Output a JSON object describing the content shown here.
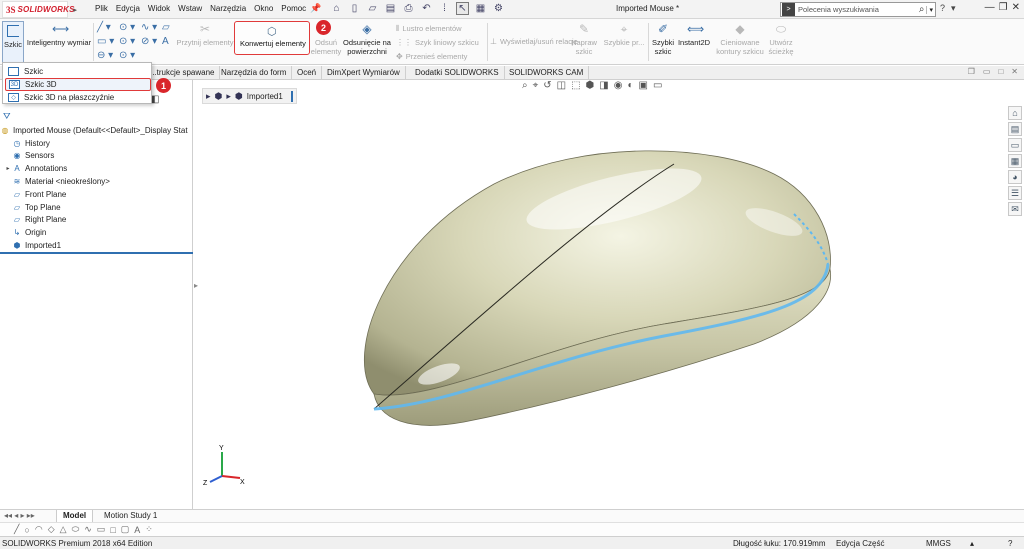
{
  "app": {
    "logo_ds": "3S",
    "logo_brand": "SOLIDWORKS",
    "document_title": "Imported Mouse *"
  },
  "menu": [
    "Plik",
    "Edycja",
    "Widok",
    "Wstaw",
    "Narzędzia",
    "Okno",
    "Pomoc"
  ],
  "search": {
    "placeholder": "Polecenia wyszukiwania"
  },
  "ribbon": {
    "szkic": "Szkic",
    "smart_dim": "Inteligentny wymiar",
    "trim": "Przytnij elementy",
    "convert": "Konwertuj elementy",
    "offset_1": "Odsuń",
    "offset_2": "elementy",
    "offset_surface_1": "Odsunięcie na",
    "offset_surface_2": "powierzchni",
    "mirror": "Lustro elementów",
    "linear_pattern": "Szyk liniowy szkicu",
    "move": "Przenieś elementy",
    "display_relations": "Wyświetlaj/usuń relacje",
    "repair_1": "Napraw",
    "repair_2": "szkic",
    "quick_snaps": "Szybkie pr...",
    "rapid_sketch_1": "Szybki",
    "rapid_sketch_2": "szkic",
    "instant2d": "Instant2D",
    "shaded_1": "Cieniowane",
    "shaded_2": "kontury szkicu",
    "create_path_1": "Utwórz",
    "create_path_2": "ścieżkę"
  },
  "dropdown": {
    "items": [
      "Szkic",
      "Szkic 3D",
      "Szkic 3D na płaszczyźnie"
    ]
  },
  "badges": {
    "step1": "1",
    "step2": "2"
  },
  "tabs": [
    "...trukcje spawane",
    "Narzędzia do form",
    "Oceń",
    "DimXpert Wymiarów",
    "Dodatki SOLIDWORKS",
    "SOLIDWORKS CAM"
  ],
  "tree": {
    "root": "Imported Mouse  (Default<<Default>_Display Stat",
    "items": [
      "History",
      "Sensors",
      "Annotations",
      "Materiał <nieokreślony>",
      "Front Plane",
      "Top Plane",
      "Right Plane",
      "Origin",
      "Imported1"
    ]
  },
  "breadcrumb": {
    "label": "Imported1"
  },
  "triad": {
    "x": "X",
    "y": "Y",
    "z": "Z"
  },
  "bottom_tabs": [
    "Model",
    "Motion Study 1"
  ],
  "status": {
    "edition": "SOLIDWORKS Premium 2018 x64 Edition",
    "arc_length": "Długość łuku: 170.919mm",
    "editing": "Edycja Część",
    "units": "MMGS"
  },
  "colors": {
    "brand_red": "#d2202f",
    "highlight_red": "#e03a3a",
    "selection_blue": "#2f6fb0",
    "model_body": "#d9d8bb",
    "edge_glow": "#5fb8f0"
  }
}
